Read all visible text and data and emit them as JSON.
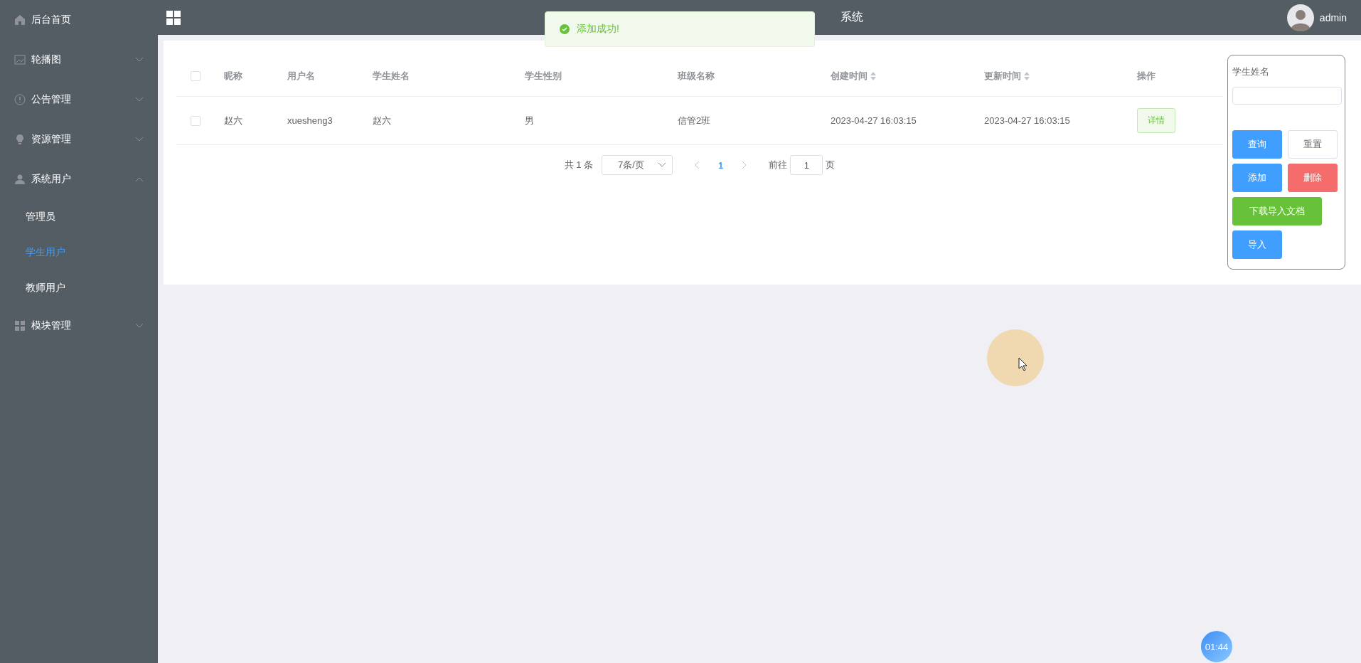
{
  "sidebar": {
    "items": [
      {
        "label": "后台首页",
        "kind": "link"
      },
      {
        "label": "轮播图",
        "kind": "group",
        "expanded": false
      },
      {
        "label": "公告管理",
        "kind": "group",
        "expanded": false
      },
      {
        "label": "资源管理",
        "kind": "group",
        "expanded": false
      },
      {
        "label": "系统用户",
        "kind": "group",
        "expanded": true,
        "children": [
          {
            "label": "管理员",
            "selected": false
          },
          {
            "label": "学生用户",
            "selected": true
          },
          {
            "label": "教师用户",
            "selected": false
          }
        ]
      },
      {
        "label": "模块管理",
        "kind": "group",
        "expanded": false
      }
    ]
  },
  "header": {
    "title": "系统",
    "user": "admin"
  },
  "toast": {
    "kind": "success",
    "message": "添加成功!"
  },
  "table": {
    "columns": [
      {
        "label": "昵称",
        "sortable": false
      },
      {
        "label": "用户名",
        "sortable": false
      },
      {
        "label": "学生姓名",
        "sortable": false
      },
      {
        "label": "学生性别",
        "sortable": false
      },
      {
        "label": "班级名称",
        "sortable": false
      },
      {
        "label": "创建时间",
        "sortable": true
      },
      {
        "label": "更新时间",
        "sortable": true
      },
      {
        "label": "操作",
        "sortable": false
      }
    ],
    "all_checked": false,
    "rows": [
      {
        "checked": false,
        "cells": [
          "赵六",
          "xuesheng3",
          "赵六",
          "男",
          "信管2班",
          "2023-04-27 16:03:15",
          "2023-04-27 16:03:15"
        ],
        "action": "详情"
      }
    ]
  },
  "pagination": {
    "total": "共 1 条",
    "page_size": "7条/页",
    "pages": [
      {
        "label": "1",
        "selected": true
      }
    ],
    "goto_label": "前往",
    "goto_value": "1",
    "goto_suffix": "页"
  },
  "filter": {
    "label": "学生姓名",
    "buttons": [
      {
        "label": "查询",
        "kind": "primary"
      },
      {
        "label": "重置",
        "kind": "default"
      },
      {
        "label": "添加",
        "kind": "primary"
      },
      {
        "label": "删除",
        "kind": "danger"
      },
      {
        "label": "下载导入文档",
        "kind": "success"
      },
      {
        "label": "导入",
        "kind": "primary"
      }
    ]
  },
  "timer": "01:44"
}
